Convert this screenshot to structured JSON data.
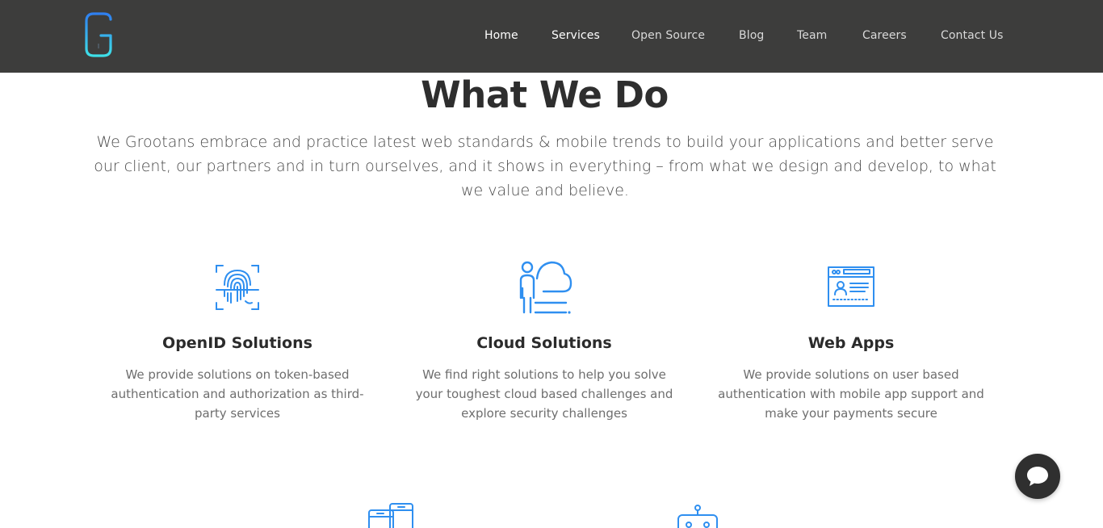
{
  "brand": {
    "accent": "#2f8ff0",
    "navbar_bg": "#3d3d3c",
    "logo_icon": "grootan-g-logo"
  },
  "nav": {
    "items": [
      {
        "label": "Home",
        "active": true
      },
      {
        "label": "Services",
        "active": true
      },
      {
        "label": "Open Source",
        "active": false
      },
      {
        "label": "Blog",
        "active": false
      },
      {
        "label": "Team",
        "active": false
      },
      {
        "label": "Careers",
        "active": false
      },
      {
        "label": "Contact Us",
        "active": false
      }
    ]
  },
  "section": {
    "title": "What We Do",
    "lead": "We Grootans embrace and practice latest web standards & mobile trends to build your applications and better serve our client, our partners and in turn ourselves, and it shows in everything – from what we design and develop, to what we value and believe."
  },
  "services": [
    {
      "icon": "fingerprint-icon",
      "title": "OpenID Solutions",
      "description": "We provide solutions on token-based authentication and authorization as third-party services"
    },
    {
      "icon": "cloud-person-icon",
      "title": "Cloud Solutions",
      "description": "We find right solutions to help you solve your toughest cloud based challenges and explore security challenges"
    },
    {
      "icon": "web-app-icon",
      "title": "Web Apps",
      "description": "We provide solutions on user based authentication with mobile app support and make your payments secure"
    }
  ],
  "more_services_icons": [
    "mobile-devices-icon",
    "robot-icon"
  ],
  "chat": {
    "icon": "chat-bubble-icon"
  }
}
